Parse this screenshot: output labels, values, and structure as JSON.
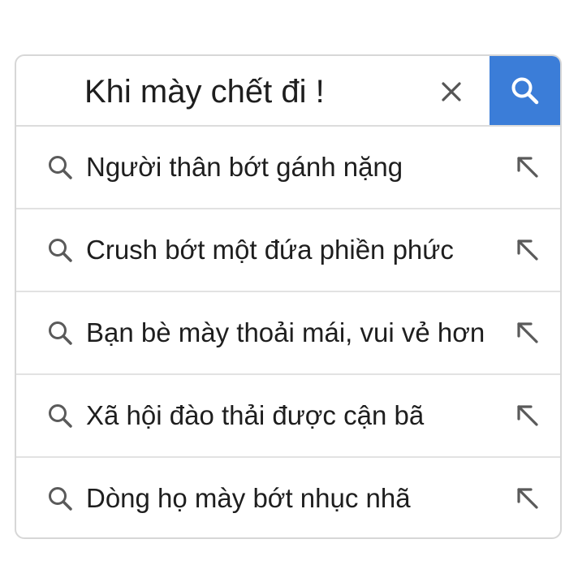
{
  "search": {
    "query": "Khi mày chết đi !",
    "clear_icon": "close-icon",
    "submit_icon": "search-icon",
    "accent_color": "#3b7dd8"
  },
  "suggestions": [
    {
      "text": "Người thân bớt gánh nặng"
    },
    {
      "text": "Crush bớt một đứa phiền phức"
    },
    {
      "text": "Bạn bè mày thoải mái, vui vẻ hơn"
    },
    {
      "text": "Xã hội đào thải được cận bã"
    },
    {
      "text": "Dòng họ mày bớt nhục nhã"
    }
  ]
}
